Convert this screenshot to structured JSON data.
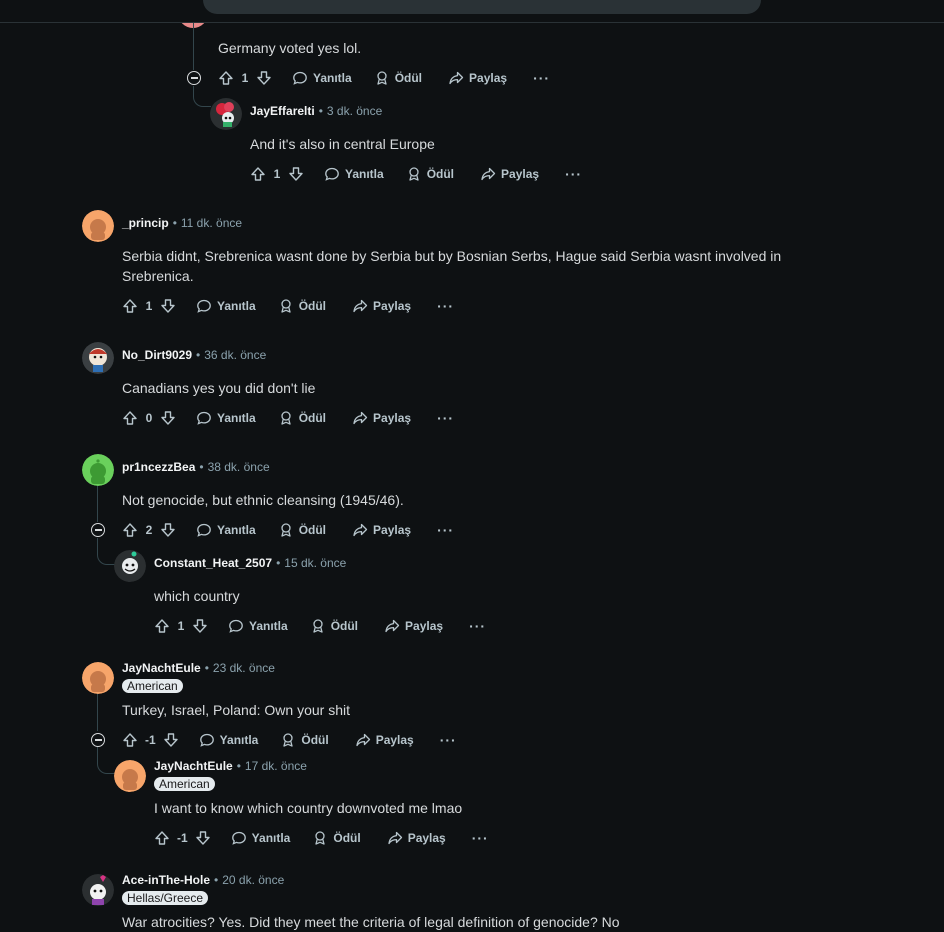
{
  "labels": {
    "reply": "Yanıtla",
    "award": "Ödül",
    "share": "Paylaş",
    "more": "···"
  },
  "comments": [
    {
      "author": "",
      "time": "",
      "text": "Germany voted yes lol.",
      "votes": "1"
    },
    {
      "author": "JayEffarelti",
      "time": "3 dk. önce",
      "text": "And it's also in central Europe",
      "votes": "1"
    },
    {
      "author": "_princip",
      "time": "11 dk. önce",
      "text": "Serbia didnt, Srebrenica wasnt done by Serbia but by Bosnian Serbs, Hague said Serbia wasnt involved in Srebrenica.",
      "votes": "1"
    },
    {
      "author": "No_Dirt9029",
      "time": "36 dk. önce",
      "text": "Canadians yes you did don't lie",
      "votes": "0"
    },
    {
      "author": "pr1ncezzBea",
      "time": "38 dk. önce",
      "text": "Not genocide, but ethnic cleansing (1945/46).",
      "votes": "2"
    },
    {
      "author": "Constant_Heat_2507",
      "time": "15 dk. önce",
      "text": "which country",
      "votes": "1"
    },
    {
      "author": "JayNachtEule",
      "time": "23 dk. önce",
      "flair": "American",
      "text": "Turkey, Israel, Poland: Own your shit",
      "votes": "-1"
    },
    {
      "author": "JayNachtEule",
      "time": "17 dk. önce",
      "flair": "American",
      "text": "I want to know which country downvoted me lmao",
      "votes": "-1"
    },
    {
      "author": "Ace-inThe-Hole",
      "time": "20 dk. önce",
      "flair": "Hellas/Greece",
      "text": "War atrocities? Yes. Did they meet the criteria of legal definition of genocide? No"
    }
  ],
  "colors": {
    "background": "#0e1113",
    "text": "#d7dadc",
    "meta": "#8ba2ad",
    "thread": "#33464c",
    "avatar_orange": "#f7a56a",
    "avatar_green": "#6ad05c"
  },
  "icons": [
    "upvote-icon",
    "downvote-icon",
    "reply-icon",
    "award-icon",
    "share-icon",
    "more-icon",
    "collapse-icon"
  ]
}
